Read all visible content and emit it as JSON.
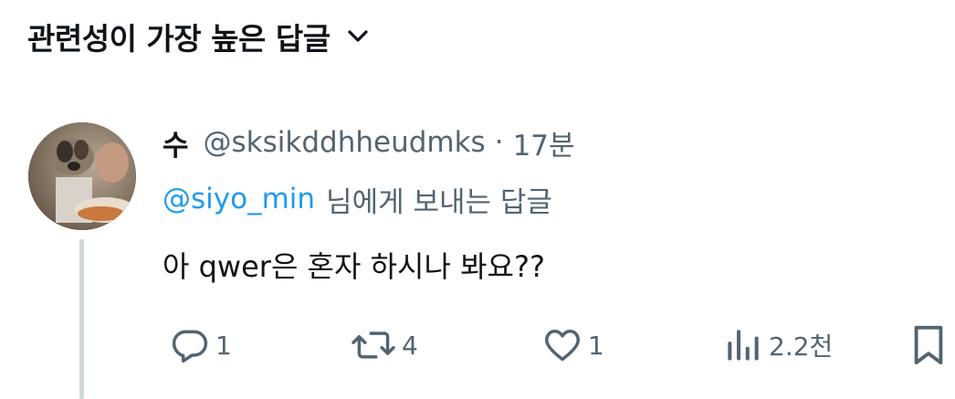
{
  "sort": {
    "label": "관련성이 가장 높은 답글",
    "icon": "chevron-down-icon"
  },
  "tweet": {
    "display_name": "수",
    "handle": "@sksikddhheudmks",
    "separator": "·",
    "time": "17분",
    "reply_to_mention": "@siyo_min",
    "reply_to_suffix": "님에게 보내는 답글",
    "text": "아 qwer은 혼자 하시나 봐요??",
    "avatar_icon": "profile-photo-dog"
  },
  "actions": {
    "reply_count": "1",
    "retweet_count": "4",
    "like_count": "1",
    "views_count": "2.2천"
  },
  "colors": {
    "text_primary": "#0f1419",
    "text_secondary": "#536471",
    "mention_blue": "#1d9bf0",
    "thread_line": "#cfd9de"
  }
}
